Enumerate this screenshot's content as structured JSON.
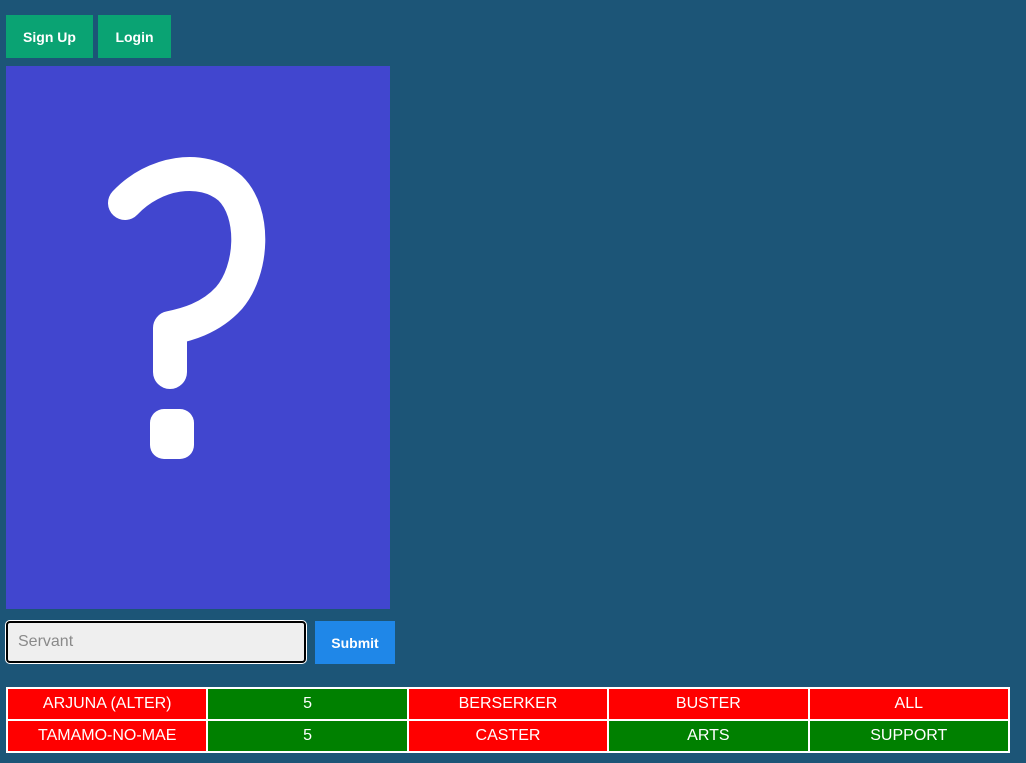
{
  "auth": {
    "signup_label": "Sign Up",
    "login_label": "Login"
  },
  "mystery_card": {
    "symbol": "question-mark",
    "background": "#4146cf"
  },
  "guess_form": {
    "placeholder": "Servant",
    "value": "",
    "submit_label": "Submit"
  },
  "colors": {
    "page_background": "#1c5577",
    "auth_button": "#0aa373",
    "submit_button": "#1f87e8",
    "match": "#008000",
    "mismatch": "#ff0000"
  },
  "guesses": [
    {
      "cells": [
        {
          "text": "ARJUNA (ALTER)",
          "status": "miss"
        },
        {
          "text": "5",
          "status": "hit"
        },
        {
          "text": "BERSERKER",
          "status": "miss"
        },
        {
          "text": "BUSTER",
          "status": "miss"
        },
        {
          "text": "ALL",
          "status": "miss"
        }
      ]
    },
    {
      "cells": [
        {
          "text": "TAMAMO-NO-MAE",
          "status": "miss"
        },
        {
          "text": "5",
          "status": "hit"
        },
        {
          "text": "CASTER",
          "status": "miss"
        },
        {
          "text": "ARTS",
          "status": "hit"
        },
        {
          "text": "SUPPORT",
          "status": "hit"
        }
      ]
    }
  ]
}
